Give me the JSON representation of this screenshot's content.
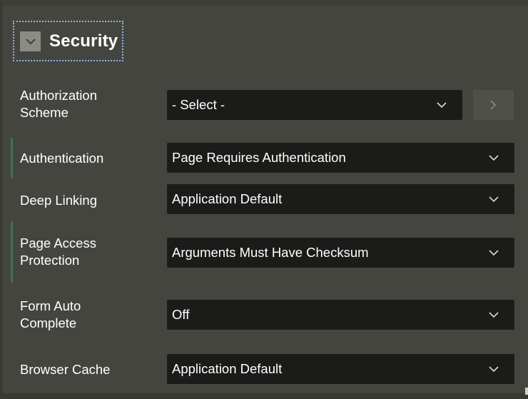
{
  "section": {
    "title": "Security"
  },
  "fields": [
    {
      "label_lines": [
        "Authorization",
        "Scheme"
      ],
      "value": "- Select -"
    },
    {
      "label_lines": [
        "Authentication"
      ],
      "value": "Page Requires Authentication"
    },
    {
      "label_lines": [
        "Deep Linking"
      ],
      "value": "Application Default"
    },
    {
      "label_lines": [
        "Page Access",
        "Protection"
      ],
      "value": "Arguments Must Have Checksum"
    },
    {
      "label_lines": [
        "Form Auto",
        "Complete"
      ],
      "value": "Off"
    },
    {
      "label_lines": [
        "Browser Cache"
      ],
      "value": "Application Default"
    }
  ],
  "icons": {
    "collapse": "chevron-down-icon",
    "dropdown": "chevron-down-icon",
    "go_to": "chevron-right-icon"
  },
  "colors": {
    "panel_bg": "#454540",
    "select_bg": "#1b1b19",
    "focus_ring": "#8fb8ea",
    "changed_marker": "#3f6e54"
  }
}
